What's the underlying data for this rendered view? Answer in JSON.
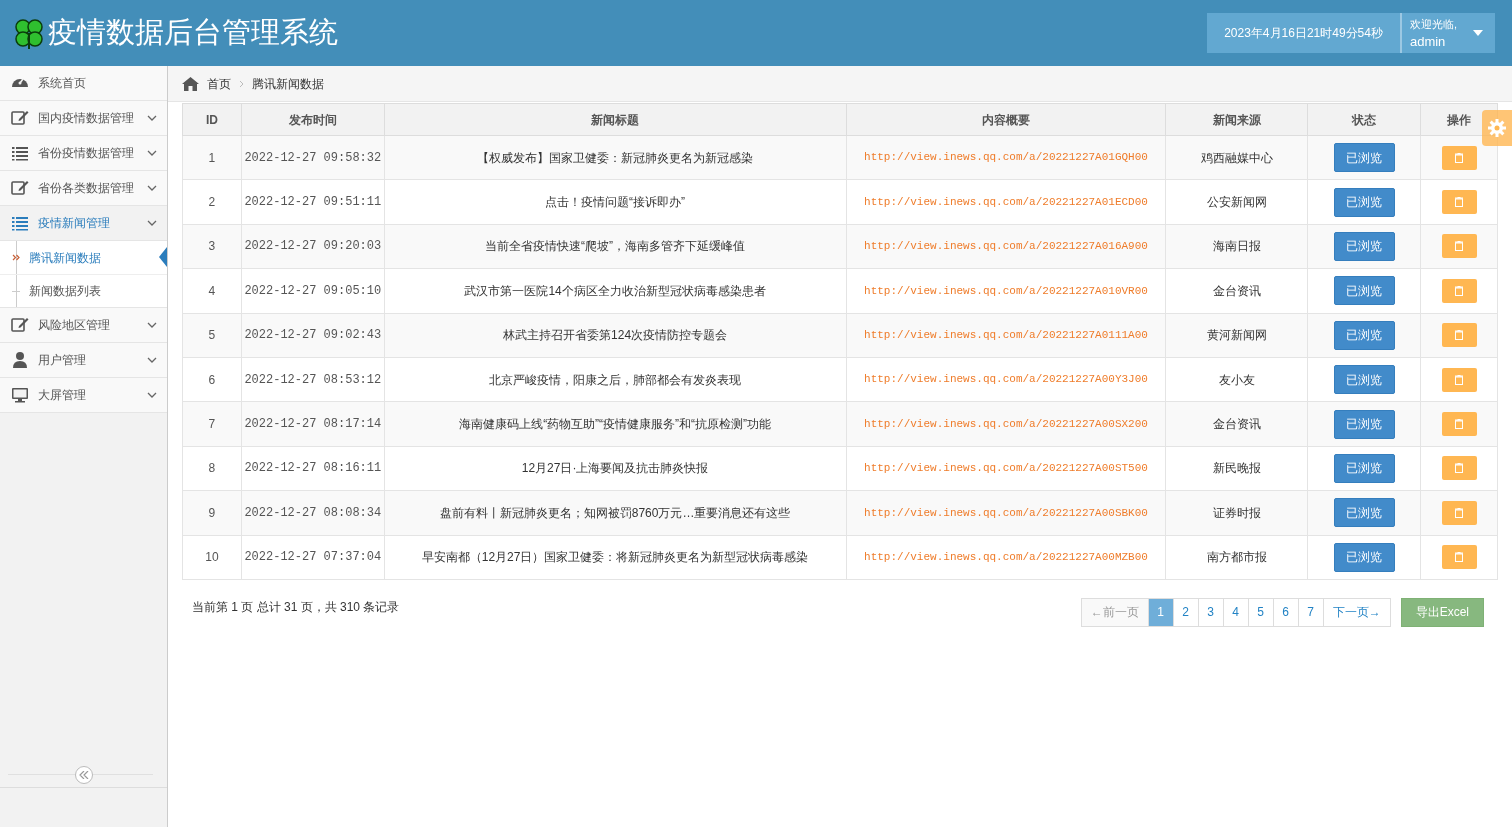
{
  "header": {
    "title": "疫情数据后台管理系统",
    "datetime": "2023年4月16日21时49分54秒",
    "welcome": "欢迎光临,",
    "user": "admin"
  },
  "sidebar": {
    "items": [
      {
        "label": "系统首页",
        "has_caret": false,
        "expanded": false
      },
      {
        "label": "国内疫情数据管理",
        "has_caret": true,
        "expanded": false
      },
      {
        "label": "省份疫情数据管理",
        "has_caret": true,
        "expanded": false
      },
      {
        "label": "省份各类数据管理",
        "has_caret": true,
        "expanded": false
      },
      {
        "label": "疫情新闻管理",
        "has_caret": true,
        "expanded": true,
        "children": [
          {
            "label": "腾讯新闻数据",
            "selected": true
          },
          {
            "label": "新闻数据列表",
            "selected": false
          }
        ]
      },
      {
        "label": "风险地区管理",
        "has_caret": true,
        "expanded": false
      },
      {
        "label": "用户管理",
        "has_caret": true,
        "expanded": false
      },
      {
        "label": "大屏管理",
        "has_caret": true,
        "expanded": false
      }
    ]
  },
  "breadcrumb": [
    "首页",
    "腾讯新闻数据"
  ],
  "table": {
    "columns": [
      "ID",
      "发布时间",
      "新闻标题",
      "内容概要",
      "新闻来源",
      "状态",
      "操作"
    ],
    "rows": [
      {
        "id": "1",
        "time": "2022-12-27 09:58:32",
        "title": "【权威发布】国家卫健委：新冠肺炎更名为新冠感染",
        "url": "http://view.inews.qq.com/a/20221227A01GQH00",
        "source": "鸡西融媒中心",
        "status": "已浏览"
      },
      {
        "id": "2",
        "time": "2022-12-27 09:51:11",
        "title": "点击！疫情问题“接诉即办”",
        "url": "http://view.inews.qq.com/a/20221227A01ECD00",
        "source": "公安新闻网",
        "status": "已浏览"
      },
      {
        "id": "3",
        "time": "2022-12-27 09:20:03",
        "title": "当前全省疫情快速“爬坡”，海南多管齐下延缓峰值",
        "url": "http://view.inews.qq.com/a/20221227A016A900",
        "source": "海南日报",
        "status": "已浏览"
      },
      {
        "id": "4",
        "time": "2022-12-27 09:05:10",
        "title": "武汉市第一医院14个病区全力收治新型冠状病毒感染患者",
        "url": "http://view.inews.qq.com/a/20221227A010VR00",
        "source": "金台资讯",
        "status": "已浏览"
      },
      {
        "id": "5",
        "time": "2022-12-27 09:02:43",
        "title": "林武主持召开省委第124次疫情防控专题会",
        "url": "http://view.inews.qq.com/a/20221227A0111A00",
        "source": "黄河新闻网",
        "status": "已浏览"
      },
      {
        "id": "6",
        "time": "2022-12-27 08:53:12",
        "title": "北京严峻疫情，阳康之后，肺部都会有发炎表现",
        "url": "http://view.inews.qq.com/a/20221227A00Y3J00",
        "source": "友小友",
        "status": "已浏览"
      },
      {
        "id": "7",
        "time": "2022-12-27 08:17:14",
        "title": "海南健康码上线“药物互助”“疫情健康服务”和“抗原检测”功能",
        "url": "http://view.inews.qq.com/a/20221227A00SX200",
        "source": "金台资讯",
        "status": "已浏览"
      },
      {
        "id": "8",
        "time": "2022-12-27 08:16:11",
        "title": "12月27日·上海要闻及抗击肺炎快报",
        "url": "http://view.inews.qq.com/a/20221227A00ST500",
        "source": "新民晚报",
        "status": "已浏览"
      },
      {
        "id": "9",
        "time": "2022-12-27 08:08:34",
        "title": "盘前有料丨新冠肺炎更名；知网被罚8760万元…重要消息还有这些",
        "url": "http://view.inews.qq.com/a/20221227A00SBK00",
        "source": "证券时报",
        "status": "已浏览"
      },
      {
        "id": "10",
        "time": "2022-12-27 07:37:04",
        "title": "早安南都（12月27日）国家卫健委：将新冠肺炎更名为新型冠状病毒感染",
        "url": "http://view.inews.qq.com/a/20221227A00MZB00",
        "source": "南方都市报",
        "status": "已浏览"
      }
    ]
  },
  "summary": "当前第 1 页 总计 31 页，共 310 条记录",
  "pagination": {
    "prev": "←前一页",
    "pages": [
      {
        "label": "1",
        "selected": true
      },
      {
        "label": "2",
        "selected": false
      },
      {
        "label": "3",
        "selected": false
      },
      {
        "label": "4",
        "selected": false
      },
      {
        "label": "5",
        "selected": false
      },
      {
        "label": "6",
        "selected": false
      },
      {
        "label": "7",
        "selected": false
      }
    ],
    "next": "下一页→"
  },
  "export_button": "导出Excel"
}
